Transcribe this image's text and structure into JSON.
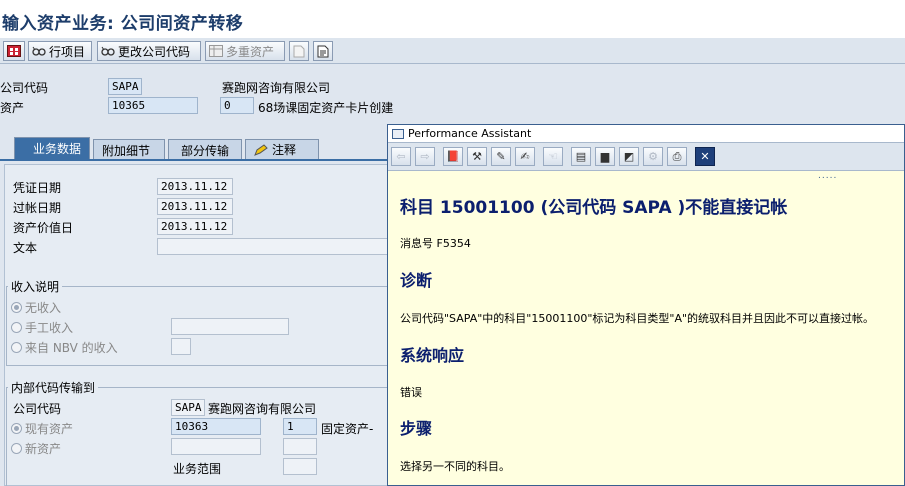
{
  "window": {
    "title": "输入资产业务: 公司间资产转移"
  },
  "toolbar": {
    "line_items": "行项目",
    "change_company": "更改公司代码",
    "multiple_assets": "多重资产"
  },
  "header": {
    "company_label": "公司代码",
    "company_value": "SAPA",
    "company_name": "赛跑网咨询有限公司",
    "asset_label": "资产",
    "asset_value": "10365",
    "sub_number": "0",
    "asset_desc": "68场课固定资产卡片创建"
  },
  "tabs": [
    {
      "label": "业务数据"
    },
    {
      "label": "附加细节"
    },
    {
      "label": "部分传输"
    },
    {
      "label": "注释"
    }
  ],
  "business": {
    "doc_date_label": "凭证日期",
    "doc_date": "2013.11.12",
    "post_date_label": "过帐日期",
    "post_date": "2013.11.12",
    "value_date_label": "资产价值日",
    "value_date": "2013.11.12",
    "text_label": "文本"
  },
  "revenue": {
    "title": "收入说明",
    "opt_none": "无收入",
    "opt_manual": "手工收入",
    "opt_nbv": "来自 NBV 的收入"
  },
  "transfer": {
    "title": "内部代码传输到",
    "company_label": "公司代码",
    "company_value": "SAPA",
    "company_name": "赛跑网咨询有限公司",
    "existing_label": "现有资产",
    "existing_value": "10363",
    "existing_sub": "1",
    "existing_desc": "固定资产-",
    "new_label": "新资产",
    "business_area_label": "业务范围"
  },
  "pa": {
    "title": "Performance Assistant",
    "heading": "科目 15001100 (公司代码 SAPA )不能直接记帐",
    "msg_no": "消息号 F5354",
    "diag_title": "诊断",
    "diag_text": "公司代码\"SAPA\"中的科目\"15001100\"标记为科目类型\"A\"的统驭科目并且因此不可以直接过帐。",
    "resp_title": "系统响应",
    "resp_text": "错误",
    "steps_title": "步骤",
    "steps_text": "选择另一不同的科目。"
  }
}
